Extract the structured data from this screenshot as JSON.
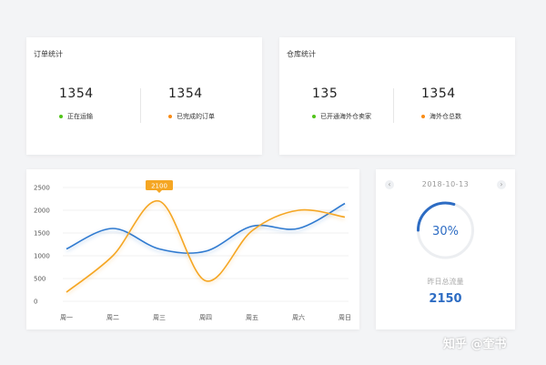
{
  "orders": {
    "title": "订单统计",
    "stats": [
      {
        "value": "1354",
        "label": "正在运输",
        "dot_color": "#52c41a"
      },
      {
        "value": "1354",
        "label": "已完成的订单",
        "dot_color": "#fa8c16"
      }
    ]
  },
  "warehouse": {
    "title": "仓库统计",
    "stats": [
      {
        "value": "135",
        "label": "已开通海外仓卖家",
        "dot_color": "#52c41a"
      },
      {
        "value": "1354",
        "label": "海外仓总数",
        "dot_color": "#fa8c16"
      }
    ]
  },
  "chart_data": {
    "type": "line",
    "categories": [
      "周一",
      "周二",
      "周三",
      "周四",
      "周五",
      "周六",
      "周日"
    ],
    "yticks": [
      "2500",
      "2000",
      "1500",
      "1000",
      "500",
      "0"
    ],
    "ylim": [
      0,
      2500
    ],
    "series": [
      {
        "color": "#2f7ad0",
        "values": [
          1150,
          1600,
          1150,
          1100,
          1650,
          1600,
          2150
        ]
      },
      {
        "color": "#f5a623",
        "values": [
          200,
          1000,
          2200,
          450,
          1550,
          2000,
          1850
        ]
      }
    ],
    "tooltip": {
      "category": "周三",
      "value": "2100",
      "color": "#f5a623"
    }
  },
  "panel": {
    "date": "2018-10-13",
    "prev_icon": "‹",
    "next_icon": "›",
    "percent_text": "30%",
    "percent": 0.3,
    "yesterday_label": "昨日总流量",
    "yesterday_value": "2150",
    "accent": "#2d6cc3"
  },
  "watermark": "知乎 @奎书"
}
